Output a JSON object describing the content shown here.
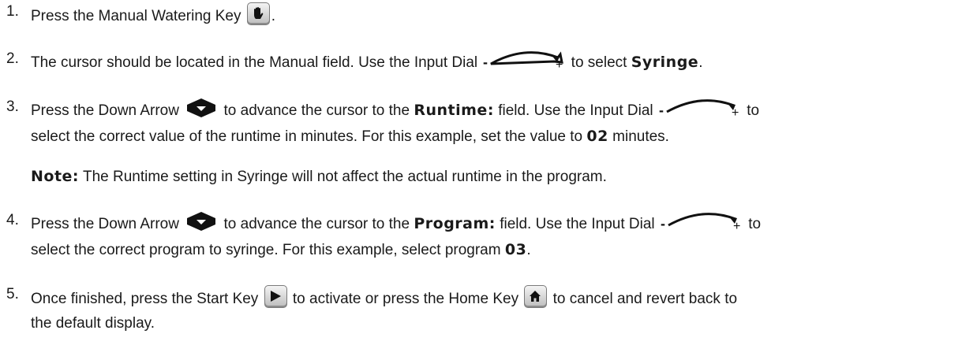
{
  "steps": [
    {
      "num": "1.",
      "parts": {
        "a": "Press the Manual Watering Key",
        "b": "."
      }
    },
    {
      "num": "2.",
      "parts": {
        "a": "The cursor should be located in the Manual field. Use the Input Dial",
        "b": "to select",
        "bold1": "Syringe",
        "c": "."
      }
    },
    {
      "num": "3.",
      "parts": {
        "a": "Press the Down Arrow",
        "b": "to advance the cursor to the",
        "bold1": "Runtime:",
        "c": "field. Use the Input Dial",
        "d": "to",
        "e": "select the correct value of the runtime in minutes. For this example, set the value to",
        "bold2": "02",
        "f": "minutes."
      }
    },
    {
      "note_label": "Note:",
      "note_text": "The Runtime setting in Syringe will not affect the actual runtime in the program."
    },
    {
      "num": "4.",
      "parts": {
        "a": "Press the Down Arrow",
        "b": "to advance the cursor to the",
        "bold1": "Program:",
        "c": "field. Use the Input Dial",
        "d": "to",
        "e": "select the correct program to syringe. For this example, select program",
        "bold2": "03",
        "f": "."
      }
    },
    {
      "num": "5.",
      "parts": {
        "a": "Once finished, press the Start Key",
        "b": "to activate or press the Home Key",
        "c": "to cancel and revert back to",
        "d": "the default display."
      }
    }
  ],
  "dial": {
    "minus": "-",
    "plus": "+"
  },
  "icons": {
    "manual": "hand-icon",
    "dial": "input-dial-icon",
    "arrow": "down-arrow-icon",
    "start": "play-icon",
    "home": "home-icon"
  }
}
